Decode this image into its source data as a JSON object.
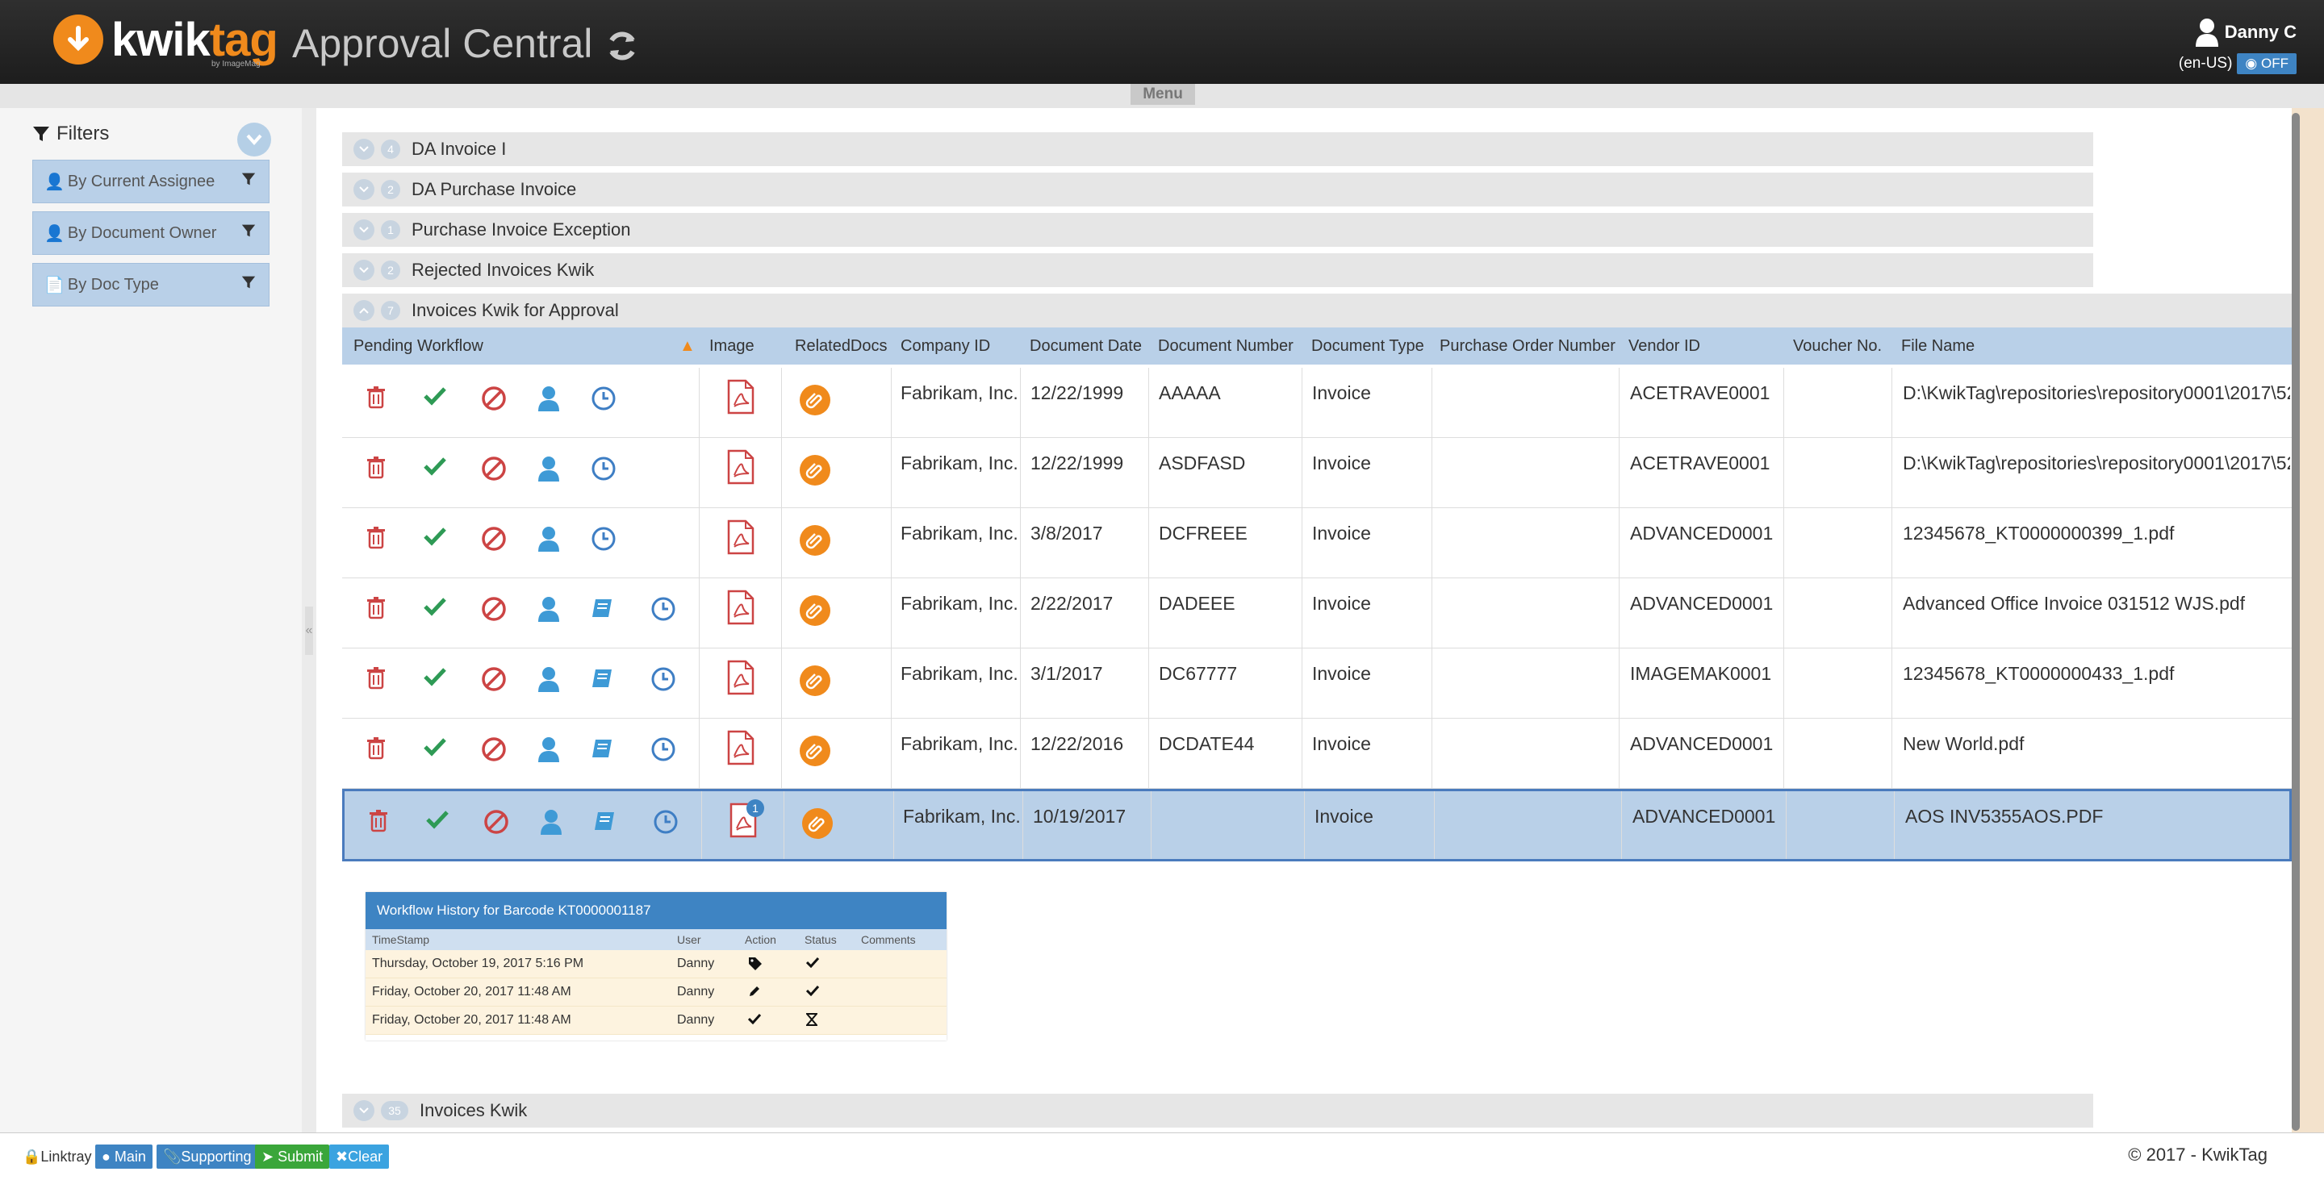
{
  "header": {
    "logo_word": "kwik",
    "logo_word_accent": "tag",
    "logo_sub": "by ImageMag",
    "app_title": "Approval Central",
    "user_name": "Danny C",
    "locale": "(en-US)",
    "toggle_label": "OFF"
  },
  "menu_label": "Menu",
  "sidebar": {
    "title": "Filters",
    "filters": [
      "By Current Assignee",
      "By Document Owner",
      "By Doc Type"
    ]
  },
  "groups": [
    {
      "count": "4",
      "label": "DA Invoice I"
    },
    {
      "count": "2",
      "label": "DA Purchase Invoice"
    },
    {
      "count": "1",
      "label": "Purchase Invoice Exception"
    },
    {
      "count": "2",
      "label": "Rejected Invoices Kwik"
    },
    {
      "count": "7",
      "label": "Invoices Kwik for Approval"
    }
  ],
  "bottom_group": {
    "count": "35",
    "label": "Invoices Kwik"
  },
  "columns": [
    "Pending Workflow",
    "Image",
    "RelatedDocs",
    "Company ID",
    "Document Date",
    "Document Number",
    "Document Type",
    "Purchase Order Number",
    "Vendor ID",
    "Voucher No.",
    "File Name"
  ],
  "rows": [
    {
      "company": "Fabrikam, Inc.",
      "date": "12/22/1999",
      "number": "AAAAA",
      "type": "Invoice",
      "po": "",
      "vendor": "ACETRAVE0001",
      "voucher": "",
      "file": "D:\\KwikTag\\repositories\\repository0001\\2017\\52",
      "extra_icons": false,
      "badge": ""
    },
    {
      "company": "Fabrikam, Inc.",
      "date": "12/22/1999",
      "number": "ASDFASD",
      "type": "Invoice",
      "po": "",
      "vendor": "ACETRAVE0001",
      "voucher": "",
      "file": "D:\\KwikTag\\repositories\\repository0001\\2017\\52",
      "extra_icons": false,
      "badge": ""
    },
    {
      "company": "Fabrikam, Inc.",
      "date": "3/8/2017",
      "number": "DCFREEE",
      "type": "Invoice",
      "po": "",
      "vendor": "ADVANCED0001",
      "voucher": "",
      "file": "12345678_KT0000000399_1.pdf",
      "extra_icons": false,
      "badge": ""
    },
    {
      "company": "Fabrikam, Inc.",
      "date": "2/22/2017",
      "number": "DADEEE",
      "type": "Invoice",
      "po": "",
      "vendor": "ADVANCED0001",
      "voucher": "",
      "file": "Advanced Office Invoice 031512 WJS.pdf",
      "extra_icons": true,
      "badge": ""
    },
    {
      "company": "Fabrikam, Inc.",
      "date": "3/1/2017",
      "number": "DC67777",
      "type": "Invoice",
      "po": "",
      "vendor": "IMAGEMAK0001",
      "voucher": "",
      "file": "12345678_KT0000000433_1.pdf",
      "extra_icons": true,
      "badge": ""
    },
    {
      "company": "Fabrikam, Inc.",
      "date": "12/22/2016",
      "number": "DCDATE44",
      "type": "Invoice",
      "po": "",
      "vendor": "ADVANCED0001",
      "voucher": "",
      "file": "New World.pdf",
      "extra_icons": true,
      "badge": ""
    },
    {
      "company": "Fabrikam, Inc.",
      "date": "10/19/2017",
      "number": "",
      "type": "Invoice",
      "po": "",
      "vendor": "ADVANCED0001",
      "voucher": "",
      "file": "AOS INV5355AOS.PDF",
      "extra_icons": true,
      "badge": "1"
    }
  ],
  "history": {
    "title": "Workflow History for Barcode KT0000001187",
    "columns": [
      "TimeStamp",
      "User",
      "Action",
      "Status",
      "Comments"
    ],
    "rows": [
      {
        "timestamp": "Thursday, October 19, 2017 5:16 PM",
        "user": "Danny",
        "action": "tag-icon",
        "status": "check-icon"
      },
      {
        "timestamp": "Friday, October 20, 2017 11:48 AM",
        "user": "Danny",
        "action": "pencil-icon",
        "status": "check-icon"
      },
      {
        "timestamp": "Friday, October 20, 2017 11:48 AM",
        "user": "Danny",
        "action": "check-icon",
        "status": "hourglass-icon"
      }
    ]
  },
  "footer": {
    "buttons": [
      "Linktray",
      "Main",
      "Supporting",
      "Submit",
      "Clear"
    ],
    "copyright": "© 2017 - KwikTag"
  },
  "colors": {
    "accent": "#f08a1c",
    "header_bg": "#b9d0e8",
    "selected_border": "#4a7bbd",
    "history_header": "#3e84c3"
  }
}
